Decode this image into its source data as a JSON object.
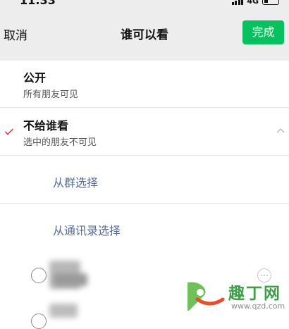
{
  "status_bar": {
    "time": "11:33",
    "network": "4G"
  },
  "nav": {
    "cancel_label": "取消",
    "title": "谁可以看",
    "done_label": "完成"
  },
  "options": [
    {
      "title": "公开",
      "subtitle": "所有朋友可见"
    },
    {
      "title": "不给谁看",
      "subtitle": "选中的朋友不可见"
    }
  ],
  "links": [
    {
      "label": "从群选择"
    },
    {
      "label": "从通讯录选择"
    }
  ],
  "colors": {
    "accent_green": "#07c160",
    "link_blue": "#576b95",
    "check_red": "#e64340",
    "nav_bg": "#ededed"
  },
  "watermark": {
    "brand": "趣丁网",
    "url": "www.qzd.com"
  }
}
